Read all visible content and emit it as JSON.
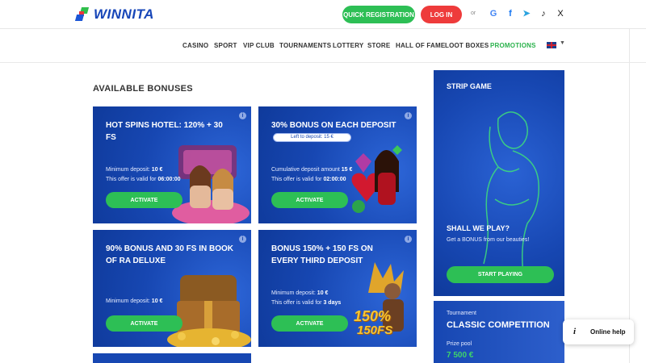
{
  "header": {
    "logo_text": "WINNITA",
    "quick_registration": "QUICK REGISTRATION",
    "login": "LOG IN",
    "or": "or",
    "social": [
      "G",
      "f",
      "➤",
      "♪",
      "X"
    ]
  },
  "nav": {
    "items": [
      "CASINO",
      "SPORT",
      "VIP CLUB",
      "TOURNAMENTS",
      "LOTTERY",
      "STORE",
      "HALL OF FAME",
      "LOOT BOXES",
      "PROMOTIONS"
    ],
    "active": "PROMOTIONS",
    "caret": "▼"
  },
  "section_title": "AVAILABLE BONUSES",
  "cards": [
    {
      "title": "HOT SPINS HOTEL: 120% + 30 FS",
      "lines": [
        {
          "label": "Minimum deposit: ",
          "value": "10 €"
        },
        {
          "label": "This offer is valid for ",
          "value": "06:00:00"
        }
      ],
      "button": "ACTIVATE"
    },
    {
      "title": "30% BONUS ON EACH DEPOSIT",
      "badge": "Left to deposit: 15 €",
      "lines": [
        {
          "label": "Cumulative deposit amount ",
          "value": "15 €"
        },
        {
          "label": "This offer is valid for ",
          "value": "02:00:00"
        }
      ],
      "button": "ACTIVATE"
    },
    {
      "title": "90% BONUS AND 30 FS IN BOOK OF RA DELUXE",
      "lines": [
        {
          "label": "Minimum deposit: ",
          "value": "10 €"
        }
      ],
      "button": "ACTIVATE"
    },
    {
      "title": "BONUS 150% + 150 FS ON EVERY THIRD DEPOSIT",
      "lines": [
        {
          "label": "Minimum deposit: ",
          "value": "10 €"
        },
        {
          "label": "This offer is valid for ",
          "value": "3 days"
        }
      ],
      "button": "ACTIVATE",
      "art_text": [
        "150%",
        "150FS"
      ]
    }
  ],
  "strip_game": {
    "title": "STRIP GAME",
    "question": "SHALL WE PLAY?",
    "subtitle": "Get a BONUS from our beauties!",
    "button": "START PLAYING"
  },
  "tournament": {
    "label": "Tournament",
    "title": "CLASSIC COMPETITION",
    "prize_label": "Prize pool",
    "prize": "7 500 €"
  },
  "help": {
    "icon": "i",
    "text": "Online help"
  },
  "colors": {
    "brand_blue": "#1747b2",
    "green": "#2dbf55",
    "red": "#ee3b3b",
    "nav_active": "#2bb24c"
  }
}
